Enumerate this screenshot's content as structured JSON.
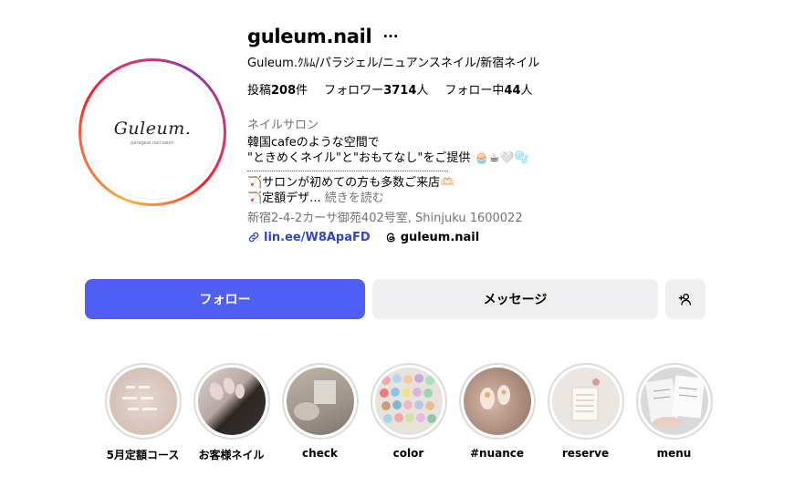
{
  "profile": {
    "username": "guleum.nail",
    "more_label": "···",
    "full_name": "Guleum.ｸﾙﾑ/パラジェル/ニュアンスネイル/新宿ネイル",
    "avatar_logo_text": "Guleum.",
    "avatar_logo_sub": "parageal nail salon",
    "stats": {
      "posts_label": "投稿",
      "posts_value": "208",
      "posts_unit": "件",
      "followers_label": "フォロワー",
      "followers_value": "3714",
      "followers_unit": "人",
      "following_label": "フォロー中",
      "following_value": "44",
      "following_unit": "人"
    },
    "category": "ネイルサロン",
    "bio": {
      "line1": "韓国cafeのような空間で",
      "line2": "\"ときめくネイル\"と\"おもてなし\"をご提供 🧁☕🤍🫧",
      "line3": "🏹サロンが初めての方も多数ご来店🫶🏻",
      "line4": "🏹定額デザ...",
      "more": " 続きを読む"
    },
    "address": "新宿2-4-2カーサ御苑402号室, Shinjuku 1600022",
    "link": "lin.ee/W8ApaFD",
    "threads": "guleum.nail"
  },
  "actions": {
    "follow": "フォロー",
    "message": "メッセージ"
  },
  "highlights": [
    {
      "label": "5月定額コース"
    },
    {
      "label": "お客様ネイル"
    },
    {
      "label": "check"
    },
    {
      "label": "color"
    },
    {
      "label": "#nuance"
    },
    {
      "label": "reserve"
    },
    {
      "label": "menu"
    }
  ],
  "colors": {
    "accent": "#4f5ff5",
    "link": "#3045c8",
    "secondary_btn": "#efeff2"
  }
}
